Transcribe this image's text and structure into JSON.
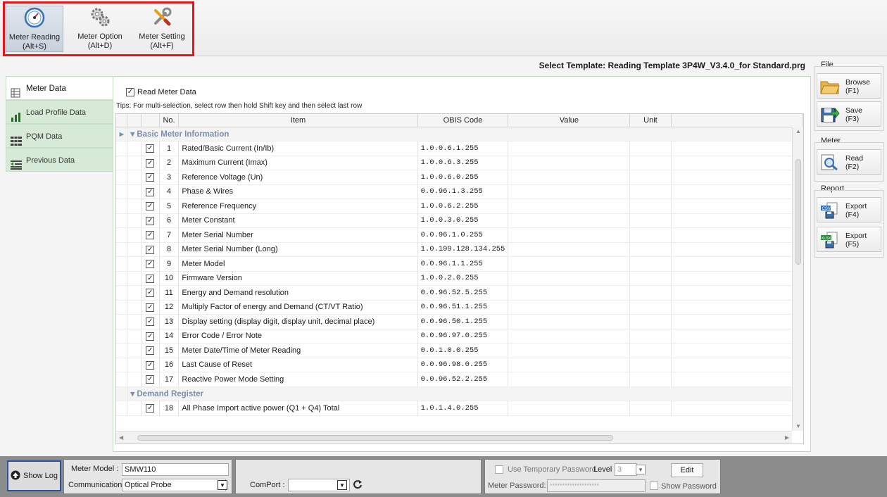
{
  "ribbon": {
    "buttons": [
      {
        "label": "Meter Reading",
        "shortcut": "(Alt+S)",
        "icon": "speedometer-icon",
        "active": true
      },
      {
        "label": "Meter Option",
        "shortcut": "(Alt+D)",
        "icon": "gears-icon",
        "active": false
      },
      {
        "label": "Meter Setting",
        "shortcut": "(Alt+F)",
        "icon": "wrench-screwdriver-icon",
        "active": false
      }
    ],
    "highlight_color": "#e8141a"
  },
  "template": {
    "label": "Select Template: Reading Template 3P4W_V3.4.0_for Standard.prg"
  },
  "nav": {
    "items": [
      {
        "label": "Meter Data",
        "icon": "table-icon"
      },
      {
        "label": "Load Profile Data",
        "icon": "bar-chart-icon"
      },
      {
        "label": "PQM Data",
        "icon": "grid-icon"
      },
      {
        "label": "Previous Data",
        "icon": "history-list-icon"
      }
    ]
  },
  "main": {
    "read_meter_label": "Read Meter Data",
    "tips": "Tips: For multi-selection, select row then hold Shift key and then select last row",
    "columns": [
      "No.",
      "Item",
      "OBIS Code",
      "Value",
      "Unit"
    ],
    "groups": [
      {
        "name": "Basic Meter Information",
        "rows": [
          {
            "no": "1",
            "item": "Rated/Basic Current (In/Ib)",
            "obis": "1.0.0.6.1.255"
          },
          {
            "no": "2",
            "item": "Maximum Current (Imax)",
            "obis": "1.0.0.6.3.255"
          },
          {
            "no": "3",
            "item": "Reference Voltage (Un)",
            "obis": "1.0.0.6.0.255"
          },
          {
            "no": "4",
            "item": "Phase & Wires",
            "obis": "0.0.96.1.3.255"
          },
          {
            "no": "5",
            "item": "Reference Frequency",
            "obis": "1.0.0.6.2.255"
          },
          {
            "no": "6",
            "item": "Meter Constant",
            "obis": "1.0.0.3.0.255"
          },
          {
            "no": "7",
            "item": "Meter Serial Number",
            "obis": "0.0.96.1.0.255"
          },
          {
            "no": "8",
            "item": "Meter Serial Number (Long)",
            "obis": "1.0.199.128.134.255"
          },
          {
            "no": "9",
            "item": "Meter Model",
            "obis": "0.0.96.1.1.255"
          },
          {
            "no": "10",
            "item": "Firmware Version",
            "obis": "1.0.0.2.0.255"
          },
          {
            "no": "11",
            "item": "Energy and Demand resolution",
            "obis": "0.0.96.52.5.255"
          },
          {
            "no": "12",
            "item": "Multiply Factor of energy and Demand (CT/VT Ratio)",
            "obis": "0.0.96.51.1.255"
          },
          {
            "no": "13",
            "item": "Display setting (display digit, display unit, decimal place)",
            "obis": "0.0.96.50.1.255"
          },
          {
            "no": "14",
            "item": "Error Code / Error Note",
            "obis": "0.0.96.97.0.255"
          },
          {
            "no": "15",
            "item": "Meter Date/Time of Meter Reading",
            "obis": "0.0.1.0.0.255"
          },
          {
            "no": "16",
            "item": "Last Cause of Reset",
            "obis": "0.0.96.98.0.255"
          },
          {
            "no": "17",
            "item": "Reactive Power Mode Setting",
            "obis": "0.0.96.52.2.255"
          }
        ]
      },
      {
        "name": "Demand Register",
        "rows": [
          {
            "no": "18",
            "item": "All Phase Import active power (Q1 + Q4) Total",
            "obis": "1.0.1.4.0.255"
          }
        ]
      }
    ]
  },
  "right": {
    "file_title": "File",
    "browse": {
      "label": "Browse",
      "shortcut": "(F1)"
    },
    "save": {
      "label": "Save",
      "shortcut": "(F3)"
    },
    "meter_title": "Meter",
    "read": {
      "label": "Read",
      "shortcut": "(F2)"
    },
    "report_title": "Report",
    "export_csv": {
      "label": "Export",
      "shortcut": "(F4)",
      "badge": "CSV"
    },
    "export_xlsx": {
      "label": "Export",
      "shortcut": "(F5)",
      "badge": "XLSX"
    }
  },
  "bottom": {
    "show_log": "Show Log",
    "meter_model_label": "Meter Model :",
    "meter_model_value": "SMW110",
    "communication_label": "Communication",
    "communication_value": "Optical Probe",
    "comport_label": "ComPort :",
    "comport_value": "",
    "temp_password_label": "Use Temporary Password",
    "level_label": "Level",
    "level_value": "3",
    "edit_label": "Edit",
    "meter_password_label": "Meter Password:",
    "meter_password_value": "********************",
    "show_password_label": "Show Password"
  }
}
